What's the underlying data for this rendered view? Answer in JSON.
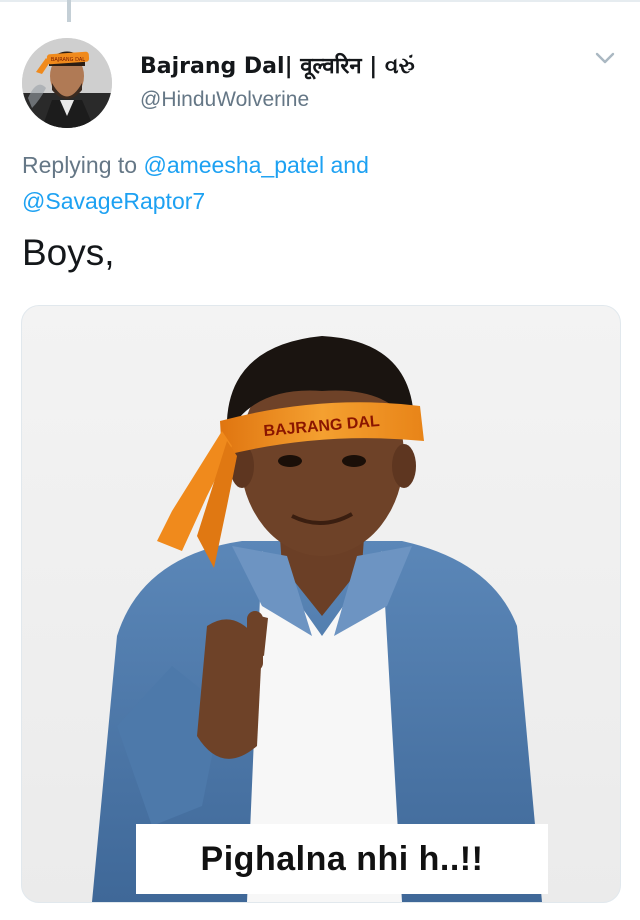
{
  "tweet": {
    "author": {
      "display_name": "Bajrang Dal| वूल्वरिन | વરું",
      "handle": "@HinduWolverine",
      "avatar_headband_text": "BAJRANG DAL"
    },
    "replying_to": {
      "prefix": "Replying to",
      "mention_1": "@ameesha_patel",
      "conjunction": "and",
      "mention_2": "@SavageRaptor7"
    },
    "text": "Boys,",
    "media": {
      "headband_text": "BAJRANG DAL",
      "caption": "Pighalna nhi h..!!"
    }
  },
  "colors": {
    "accent": "#1da1f2",
    "secondary_text": "#657786",
    "primary_text": "#14171a",
    "headband": "#f08a1c"
  },
  "icons": {
    "menu": "chevron-down-icon"
  }
}
